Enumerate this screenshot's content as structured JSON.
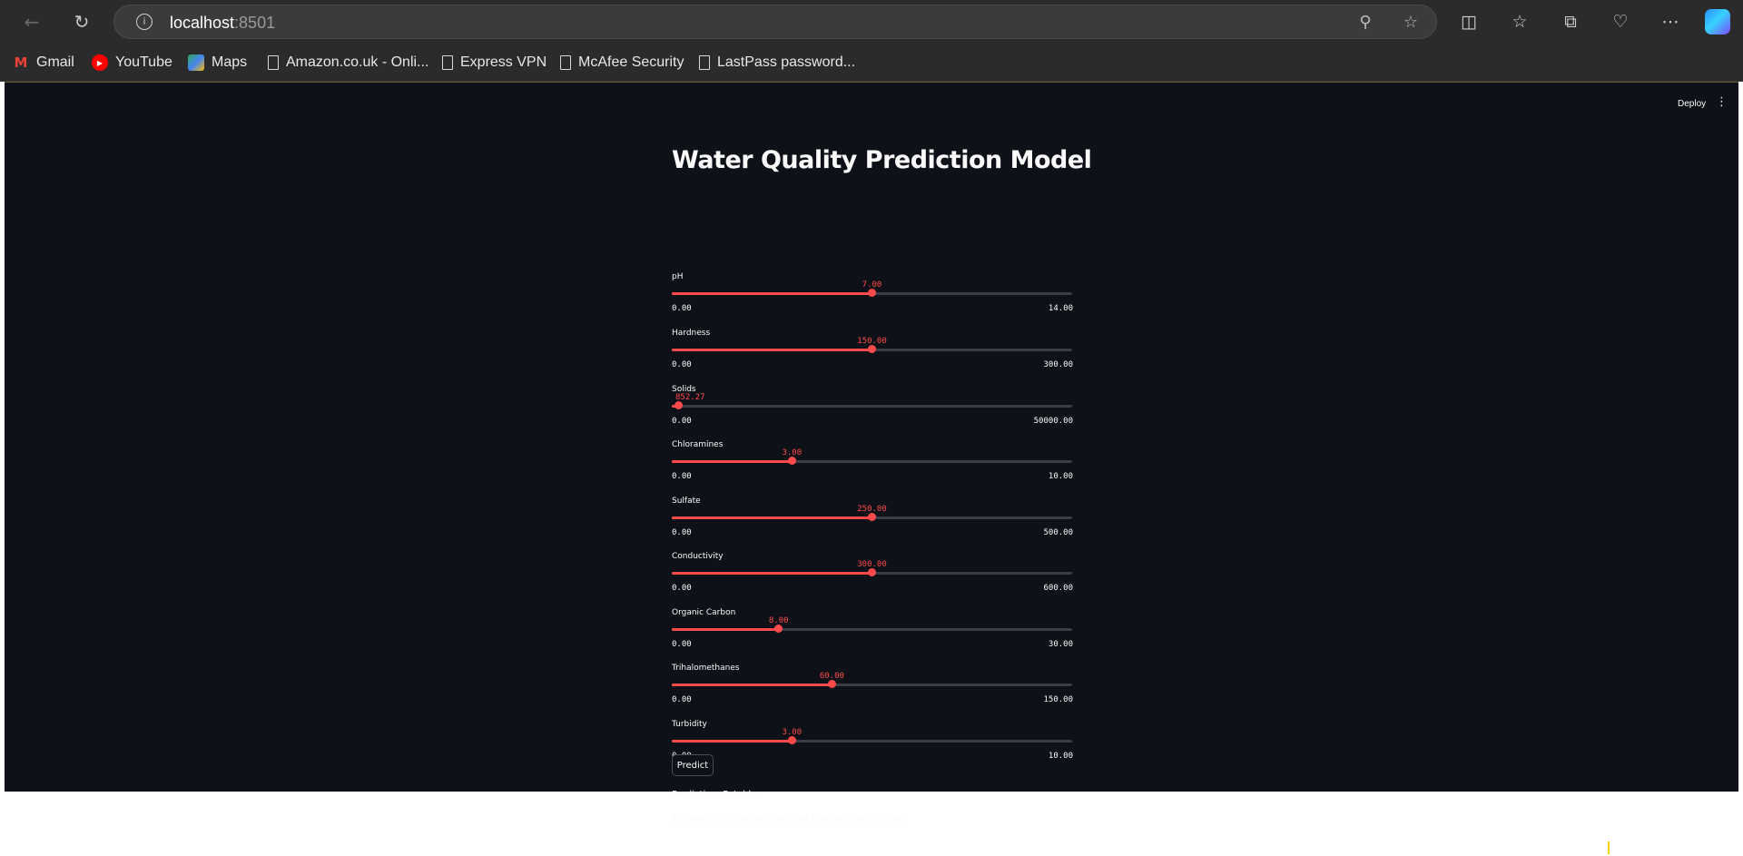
{
  "browser": {
    "url_host": "localhost",
    "url_port": ":8501",
    "bookmarks": [
      {
        "label": "Gmail",
        "icon": "gmail-icon"
      },
      {
        "label": "YouTube",
        "icon": "youtube-icon"
      },
      {
        "label": "Maps",
        "icon": "maps-icon"
      },
      {
        "label": "Amazon.co.uk - Onli...",
        "icon": "page-icon"
      },
      {
        "label": "Express VPN",
        "icon": "page-icon"
      },
      {
        "label": "McAfee Security",
        "icon": "page-icon"
      },
      {
        "label": "LastPass password...",
        "icon": "page-icon"
      }
    ]
  },
  "app": {
    "deploy_label": "Deploy",
    "title": "Water Quality Prediction Model",
    "accent_color": "#ff4b4b",
    "sliders": [
      {
        "label": "pH",
        "value": "7.00",
        "min": "0.00",
        "max": "14.00",
        "fraction": 0.5
      },
      {
        "label": "Hardness",
        "value": "150.00",
        "min": "0.00",
        "max": "300.00",
        "fraction": 0.5
      },
      {
        "label": "Solids",
        "value": "852.27",
        "min": "0.00",
        "max": "50000.00",
        "fraction": 0.017
      },
      {
        "label": "Chloramines",
        "value": "3.00",
        "min": "0.00",
        "max": "10.00",
        "fraction": 0.3
      },
      {
        "label": "Sulfate",
        "value": "250.00",
        "min": "0.00",
        "max": "500.00",
        "fraction": 0.5
      },
      {
        "label": "Conductivity",
        "value": "300.00",
        "min": "0.00",
        "max": "600.00",
        "fraction": 0.5
      },
      {
        "label": "Organic Carbon",
        "value": "8.00",
        "min": "0.00",
        "max": "30.00",
        "fraction": 0.267
      },
      {
        "label": "Trihalomethanes",
        "value": "60.00",
        "min": "0.00",
        "max": "150.00",
        "fraction": 0.4
      },
      {
        "label": "Turbidity",
        "value": "3.00",
        "min": "0.00",
        "max": "10.00",
        "fraction": 0.3
      }
    ],
    "predict_label": "Predict",
    "prediction_text": "Prediction: Potable",
    "message_text": "The water is pure and safe for human consumption."
  }
}
